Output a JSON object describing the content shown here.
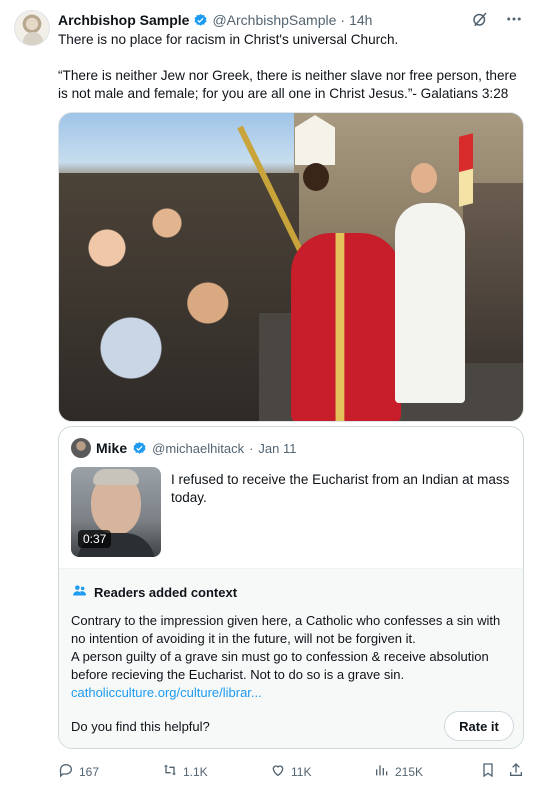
{
  "tweet": {
    "author_name": "Archbishop Sample",
    "handle": "@ArchbishpSample",
    "separator": "·",
    "time": "14h",
    "text": "There is no place for racism in Christ's universal Church.\n\n“There is neither Jew nor Greek, there is neither slave nor free person, there is not male and female; for you are all one in Christ Jesus.”- Galatians 3:28",
    "icons": [
      "verified-badge-icon",
      "grok-icon",
      "more-icon"
    ]
  },
  "quoted": {
    "author_name": "Mike",
    "handle": "@michaelhitack",
    "separator": "·",
    "date": "Jan 11",
    "text": "I refused to receive the Eucharist from an Indian at mass today.",
    "video_duration": "0:37"
  },
  "context_note": {
    "title": "Readers added context",
    "body_lines": [
      "Contrary to the impression given here, a Catholic who confesses a sin with no intention of avoiding it in the future, will not be forgiven it.",
      "A person guilty of a grave sin must go to confession & receive absolution before recieving the Eucharist. Not to do so is a grave sin."
    ],
    "link": "catholicculture.org/culture/librar...",
    "helpful_prompt": "Do you find this helpful?",
    "rate_label": "Rate it"
  },
  "actions": {
    "replies": "167",
    "reposts": "1.1K",
    "likes": "11K",
    "views": "215K"
  },
  "colors": {
    "accent": "#1d9bf0",
    "muted": "#536471",
    "border": "#cfd9de",
    "note_bg": "#f7f9f9"
  }
}
